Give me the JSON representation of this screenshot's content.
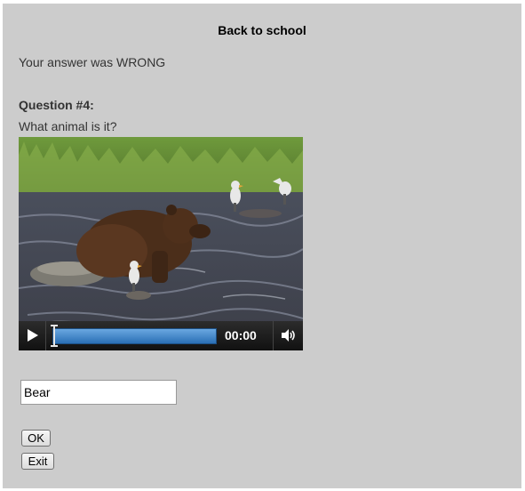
{
  "page": {
    "title": "Back to school",
    "result_message": "Your answer was WRONG"
  },
  "question": {
    "heading": "Question #4:",
    "text": "What animal is it?"
  },
  "video": {
    "time": "00:00",
    "progress_fraction": 0,
    "play_icon": "play-icon",
    "volume_icon": "volume-icon"
  },
  "answer": {
    "value": "Bear"
  },
  "buttons": {
    "ok_label": "OK",
    "exit_label": "Exit"
  },
  "colors": {
    "panel_background": "#cccccc",
    "progress_bar": "#3a82c8"
  }
}
